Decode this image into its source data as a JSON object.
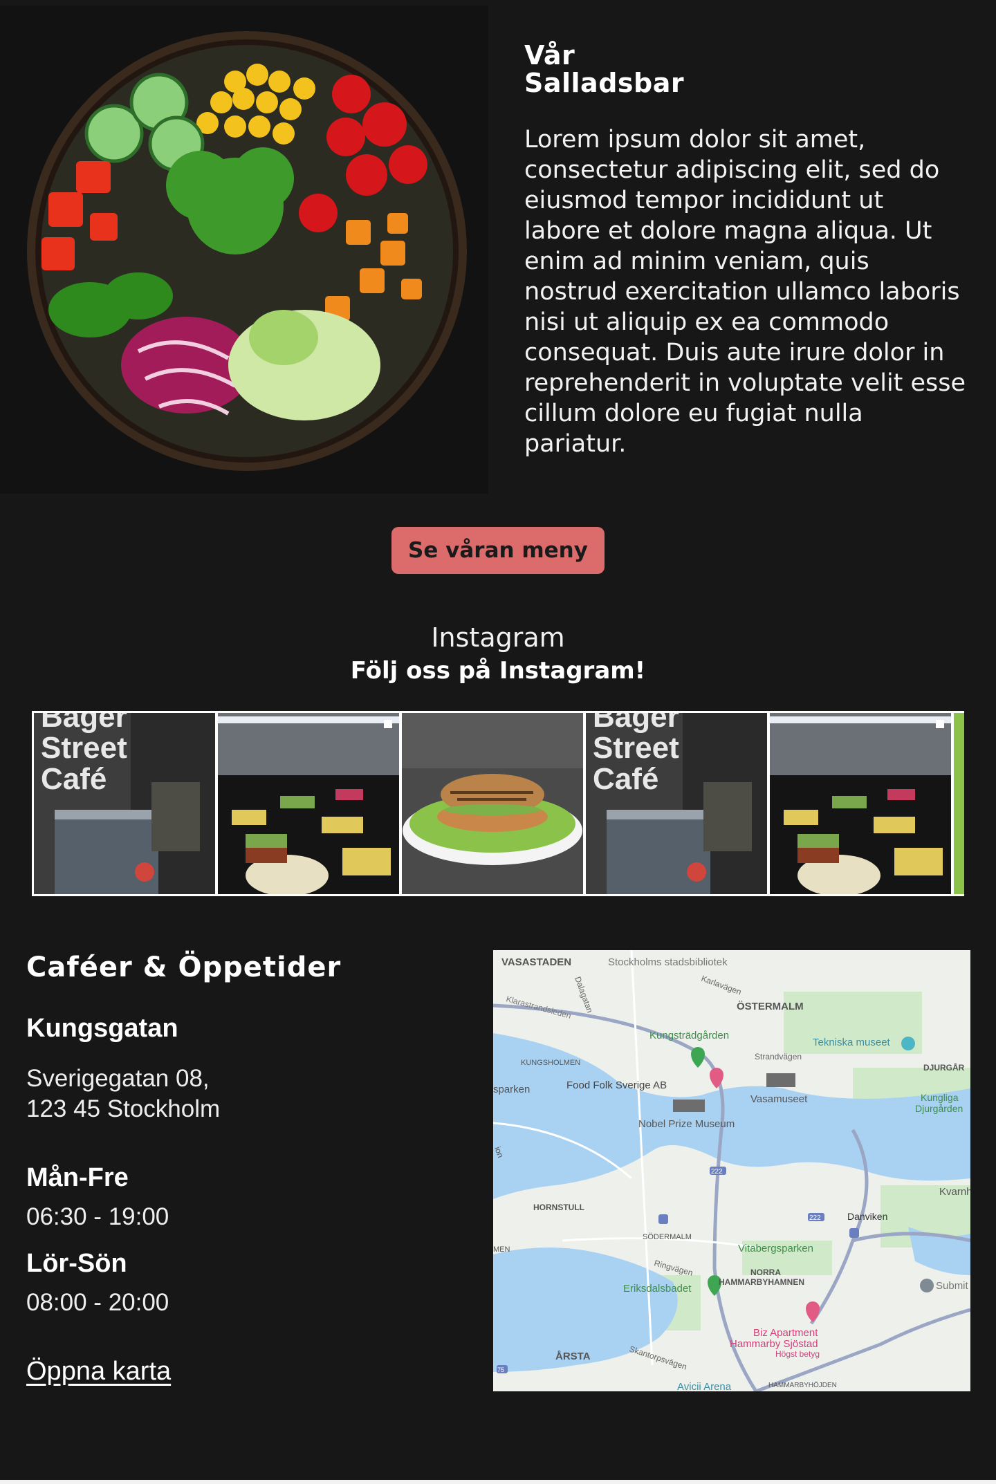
{
  "hero": {
    "image_icon": "salad-bowl-image",
    "title_line1": "Vår",
    "title_line2": "Salladsbar",
    "body": "Lorem ipsum dolor sit amet, consectetur adipiscing elit, sed do eiusmod tempor incididunt ut labore et dolore magna aliqua. Ut enim ad minim veniam, quis nostrud exercitation ullamco laboris nisi ut aliquip ex ea commodo consequat. Duis aute irure dolor in reprehenderit in voluptate velit esse cillum dolore eu fugiat nulla pariatur."
  },
  "menu_button": {
    "label": "Se våran meny"
  },
  "instagram": {
    "heading": "Instagram",
    "subheading": "Följ oss på Instagram!",
    "tiles": [
      {
        "kind": "cafe-sign",
        "sign_text": [
          "Bager",
          "Street",
          "Café"
        ]
      },
      {
        "kind": "salad-bar"
      },
      {
        "kind": "burger"
      },
      {
        "kind": "cafe-sign",
        "sign_text": [
          "Bager",
          "Street",
          "Café"
        ]
      },
      {
        "kind": "salad-bar"
      }
    ]
  },
  "hours": {
    "title": "Caféer & Öppetider",
    "location": "Kungsgatan",
    "address_line1": "Sverigegatan 08,",
    "address_line2": "123 45 Stockholm",
    "weekday_label": "Mån-Fre",
    "weekday_hours": "06:30 - 19:00",
    "weekend_label": "Lör-Sön",
    "weekend_hours": "08:00 - 20:00",
    "map_link": "Öppna karta"
  },
  "map": {
    "labels": {
      "vasastaden": "VASASTADEN",
      "stadsbibliotek": "Stockholms stadsbibliotek",
      "karlavagen": "Karlavägen",
      "ostermalm": "ÖSTERMALM",
      "dalagatan": "Dalagatan",
      "klarastrandsleden": "Klarastrandsleden",
      "kungstradgarden": "Kungsträdgården",
      "tekniska": "Tekniska museet",
      "strandvagen": "Strandvägen",
      "djurgarden": "DJURGÅR",
      "kungsholmen": "KUNGSHOLMEN",
      "foodfolk": "Food Folk Sverige AB",
      "vasamuseet": "Vasamuseet",
      "kungliga": "Kungliga",
      "djurgarden2": "Djurgården",
      "sparken": "sparken",
      "nobel": "Nobel Prize Museum",
      "kvarn": "Kvarnh",
      "hornstull": "HORNSTULL",
      "danviken": "Danviken",
      "sodermalm": "SÖDERMALM",
      "vitabergsparken": "Vitabergsparken",
      "men": "MEN",
      "ringvagen": "Ringvägen",
      "norra": "NORRA",
      "hammarbyhamnen": "HAMMARBYHAMNEN",
      "eriksdalsbadet": "Eriksdalsbadet",
      "submit": "Submit",
      "biz1": "Biz Apartment",
      "biz2": "Hammarby Sjöstad",
      "biz3": "Högst betyg",
      "arsta": "ÅRSTA",
      "skanstorp": "Skantorpsvägen",
      "avicii": "Avicii Arena",
      "hammarbyhojden": "HAMMARBYHÖJDEN",
      "r222a": "222",
      "r222b": "222",
      "r75": "75",
      "ion": "ion"
    }
  }
}
